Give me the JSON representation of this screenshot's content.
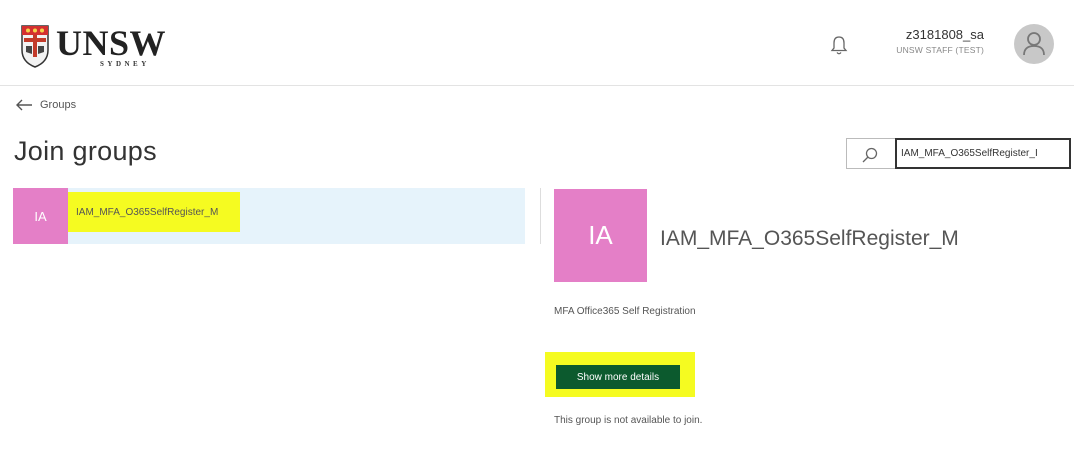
{
  "header": {
    "logo_text": "UNSW",
    "logo_subtext": "SYDNEY",
    "user_name": "z3181808_sa",
    "user_role": "UNSW STAFF (TEST)",
    "icons": {
      "notifications": "bell-icon",
      "avatar": "person-icon"
    }
  },
  "nav": {
    "back_label": "Groups",
    "back_icon": "arrow-left-icon"
  },
  "page": {
    "title": "Join groups"
  },
  "search": {
    "value": "IAM_MFA_O365SelfRegister_I",
    "icon": "search-icon"
  },
  "results": [
    {
      "initials": "IA",
      "name": "IAM_MFA_O365SelfRegister_M"
    }
  ],
  "detail": {
    "initials": "IA",
    "name": "IAM_MFA_O365SelfRegister_M",
    "description": "MFA Office365 Self Registration",
    "more_button": "Show more details",
    "notice": "This group is not available to join."
  },
  "colors": {
    "group_avatar": "#e47fc7",
    "selected_row": "#e6f3fb",
    "highlight": "#f5fb21",
    "button": "#0c5a2e"
  }
}
